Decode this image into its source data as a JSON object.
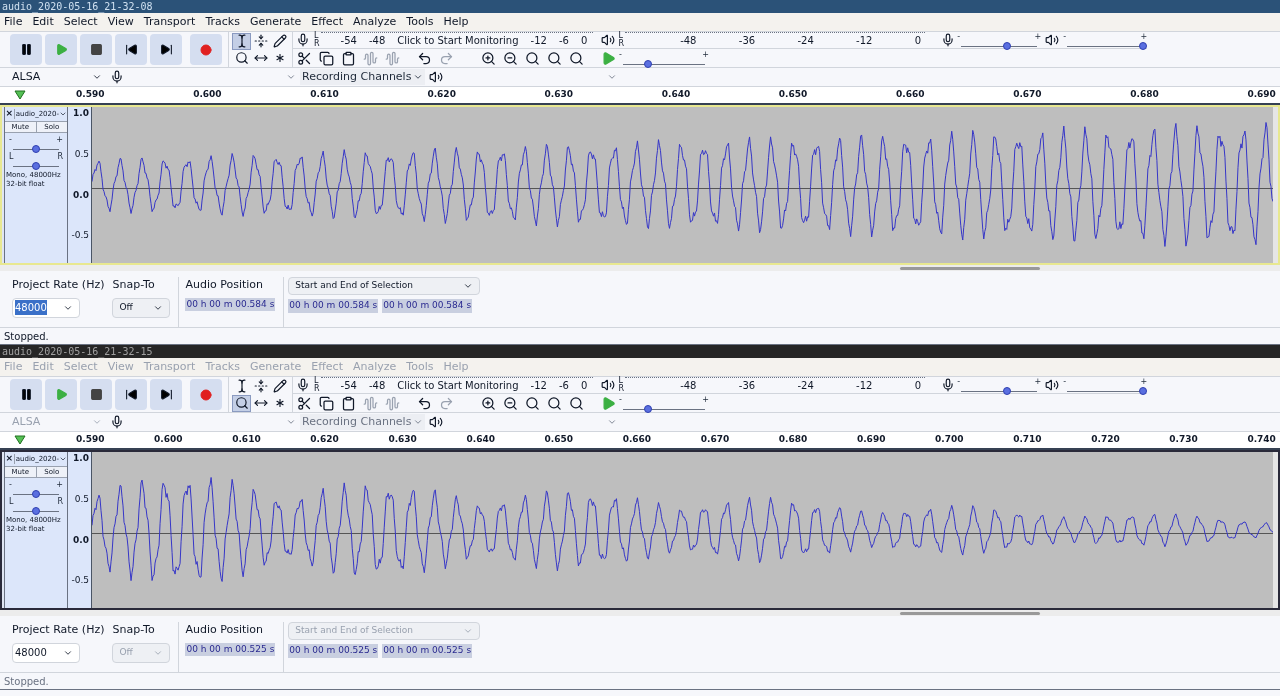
{
  "windows": [
    {
      "title": "audio_2020-05-16_21-32-08",
      "active": true,
      "menu": [
        "File",
        "Edit",
        "Select",
        "View",
        "Transport",
        "Tracks",
        "Generate",
        "Effect",
        "Analyze",
        "Tools",
        "Help"
      ],
      "tools": [
        {
          "kind": "select",
          "selected": true
        },
        {
          "kind": "envelope",
          "selected": false
        },
        {
          "kind": "draw",
          "selected": false
        },
        {
          "kind": "zoom",
          "selected": false
        },
        {
          "kind": "timeshift",
          "selected": false
        },
        {
          "kind": "multi",
          "selected": false
        }
      ],
      "record_meter": {
        "channels": [
          "L",
          "R"
        ],
        "labels_before": [
          "-54",
          "-48"
        ],
        "prompt": "Click to Start Monitoring",
        "labels_after": [
          "-12",
          "-6",
          "0"
        ]
      },
      "playback_meter": {
        "channels": [
          "L",
          "R"
        ],
        "labels": [
          "-48",
          "-36",
          "-24",
          "-12",
          "0"
        ]
      },
      "play_speed": {
        "min": "-",
        "max": "+",
        "level": 0.3
      },
      "record_volume": {
        "min": "-",
        "max": "+",
        "level": 0.6
      },
      "playback_volume": {
        "min": "-",
        "max": "+",
        "level": 1.0
      },
      "devices": {
        "host": "ALSA",
        "channels": "Recording Channels"
      },
      "ruler": [
        "0.590",
        "0.600",
        "0.610",
        "0.620",
        "0.630",
        "0.640",
        "0.650",
        "0.660",
        "0.670",
        "0.680",
        "0.690"
      ],
      "track": {
        "close": "×",
        "name": "audio_2020-",
        "mute": "Mute",
        "solo": "Solo",
        "gain": {
          "min": "-",
          "max": "+",
          "level": 0.5
        },
        "pan": {
          "min": "L",
          "max": "R",
          "level": 0.5
        },
        "info": [
          "Mono, 48000Hz",
          "32-bit float"
        ],
        "focused": true,
        "y_axis": [
          "1.0",
          "0.5",
          "0.0",
          "-0.5"
        ]
      },
      "selection_bar": {
        "rate_label": "Project Rate (Hz)",
        "rate": "48000",
        "rate_highlighted": true,
        "snap_label": "Snap-To",
        "snap": "Off",
        "position_label": "Audio Position",
        "position": "00 h 00 m 00.584 s",
        "mode": "Start and End of Selection",
        "start": "00 h 00 m 00.584 s",
        "end": "00 h 00 m 00.584 s"
      },
      "status": "Stopped."
    },
    {
      "title": "audio_2020-05-16_21-32-15",
      "active": false,
      "menu": [
        "File",
        "Edit",
        "Select",
        "View",
        "Transport",
        "Tracks",
        "Generate",
        "Effect",
        "Analyze",
        "Tools",
        "Help"
      ],
      "tools": [
        {
          "kind": "select",
          "selected": false
        },
        {
          "kind": "envelope",
          "selected": false
        },
        {
          "kind": "draw",
          "selected": false
        },
        {
          "kind": "zoom",
          "selected": true
        },
        {
          "kind": "timeshift",
          "selected": false
        },
        {
          "kind": "multi",
          "selected": false
        }
      ],
      "record_meter": {
        "channels": [
          "L",
          "R"
        ],
        "labels_before": [
          "-54",
          "-48"
        ],
        "prompt": "Click to Start Monitoring",
        "labels_after": [
          "-12",
          "-6",
          "0"
        ]
      },
      "playback_meter": {
        "channels": [
          "L",
          "R"
        ],
        "labels": [
          "-48",
          "-36",
          "-24",
          "-12",
          "0"
        ]
      },
      "play_speed": {
        "min": "-",
        "max": "+",
        "level": 0.3
      },
      "record_volume": {
        "min": "-",
        "max": "+",
        "level": 0.6
      },
      "playback_volume": {
        "min": "-",
        "max": "+",
        "level": 1.0
      },
      "devices": {
        "host": "ALSA",
        "channels": "Recording Channels"
      },
      "ruler": [
        "0.590",
        "0.600",
        "0.610",
        "0.620",
        "0.630",
        "0.640",
        "0.650",
        "0.660",
        "0.670",
        "0.680",
        "0.690",
        "0.700",
        "0.710",
        "0.720",
        "0.730",
        "0.740"
      ],
      "track": {
        "close": "×",
        "name": "audio_2020-",
        "mute": "Mute",
        "solo": "Solo",
        "gain": {
          "min": "-",
          "max": "+",
          "level": 0.5
        },
        "pan": {
          "min": "L",
          "max": "R",
          "level": 0.5
        },
        "info": [
          "Mono, 48000Hz",
          "32-bit float"
        ],
        "focused": false,
        "y_axis": [
          "1.0",
          "0.5",
          "0.0",
          "-0.5"
        ]
      },
      "selection_bar": {
        "rate_label": "Project Rate (Hz)",
        "rate": "48000",
        "rate_highlighted": false,
        "snap_label": "Snap-To",
        "snap": "Off",
        "position_label": "Audio Position",
        "position": "00 h 00 m 00.525 s",
        "mode": "Start and End of Selection",
        "start": "00 h 00 m 00.525 s",
        "end": "00 h 00 m 00.525 s"
      },
      "status": "Stopped."
    }
  ]
}
